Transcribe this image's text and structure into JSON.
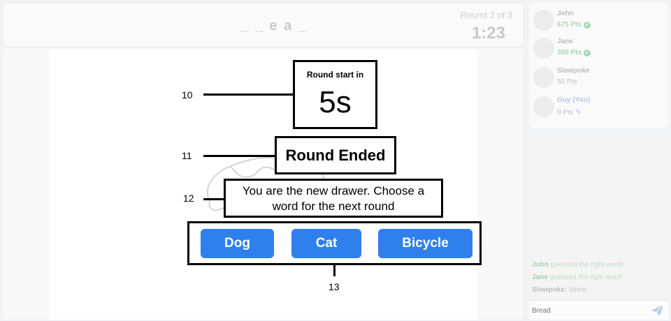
{
  "header": {
    "word_hint": "_ _ e a _",
    "round": "Round 2 of 3",
    "timer": "1:23"
  },
  "players": [
    {
      "name": "John",
      "points": "675 Pts",
      "guessed": true
    },
    {
      "name": "Jane",
      "points": "300 Pts",
      "guessed": true
    },
    {
      "name": "Slowpoke",
      "points": "50 Pts",
      "guessed": false
    },
    {
      "name": "Guy (You)",
      "points": "0 Pts",
      "guessed": false,
      "drawing": true
    }
  ],
  "chat": {
    "messages": [
      {
        "user": "John",
        "text": " guessed the right word!"
      },
      {
        "user": "Jane",
        "text": " guessed the right word!"
      },
      {
        "user": "Slowpoke:",
        "text": " Veear"
      }
    ],
    "input_placeholder": "Bread"
  },
  "overlay": {
    "countdown_label": "Round start in",
    "countdown_value": "5s",
    "round_ended": "Round Ended",
    "drawer_message": "You are the new drawer. Choose a word for the next round",
    "word_choices": [
      "Dog",
      "Cat",
      "Bicycle"
    ]
  },
  "callouts": [
    "10",
    "11",
    "12",
    "13"
  ],
  "colors": {
    "button_blue": "#2f80ed",
    "guessed_green": "#a9d7b5"
  }
}
